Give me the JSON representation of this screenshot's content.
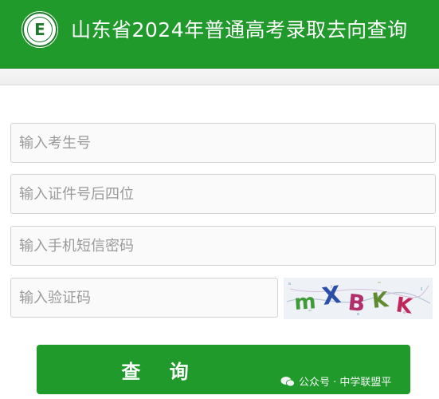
{
  "header": {
    "title": "山东省2024年普通高考录取去向查询",
    "logo_icon": "school-emblem-icon",
    "background_color": "#1f9a2b"
  },
  "form": {
    "exam_number": {
      "value": "",
      "placeholder": "输入考生号"
    },
    "id_last4": {
      "value": "",
      "placeholder": "输入证件号后四位"
    },
    "sms_password": {
      "value": "",
      "placeholder": "输入手机短信密码"
    },
    "captcha_input": {
      "value": "",
      "placeholder": "输入验证码"
    },
    "captcha_image": {
      "text": "mXBKK"
    },
    "submit_label": "查 询"
  },
  "watermark": {
    "text": "公众号 · 中学联盟平",
    "icon": "wechat-icon"
  }
}
